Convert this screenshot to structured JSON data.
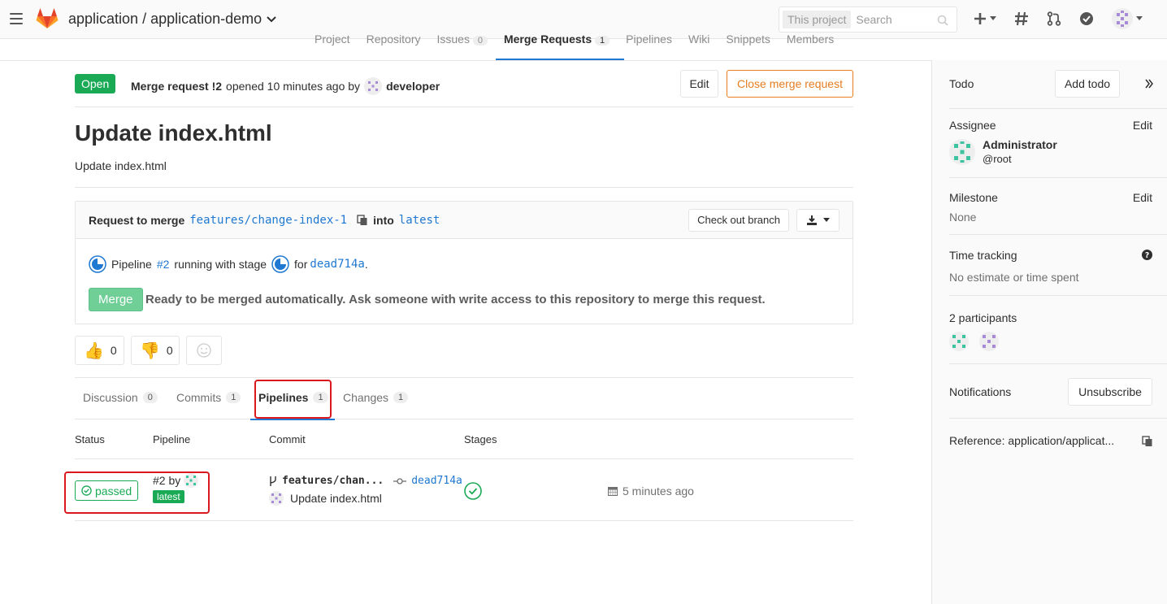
{
  "header": {
    "project_path": "application / application-demo",
    "search_scope": "This project",
    "search_placeholder": "Search"
  },
  "subnav": [
    "Project",
    "Repository",
    "Issues",
    "Merge Requests",
    "Pipelines",
    "Wiki",
    "Snippets",
    "Members"
  ],
  "subnav_counts": {
    "issues": "0",
    "merge_requests": "1"
  },
  "mr": {
    "status": "Open",
    "ref": "Merge request !2",
    "opened": "opened 10 minutes ago by",
    "author": "developer",
    "edit_label": "Edit",
    "close_label": "Close merge request",
    "title": "Update index.html",
    "description": "Update index.html"
  },
  "widget": {
    "request_to_merge": "Request to merge",
    "source_branch": "features/change-index-1",
    "into": "into",
    "target_branch": "latest",
    "checkout_label": "Check out branch",
    "pipeline_prefix": "Pipeline",
    "pipeline_id": "#2",
    "pipeline_running": "running with stage",
    "pipeline_for": "for",
    "commit_sha": "dead714a",
    "merge_label": "Merge",
    "merge_text": "Ready to be merged automatically. Ask someone with write access to this repository to merge this request."
  },
  "awards": {
    "thumbsup": "0",
    "thumbsdown": "0"
  },
  "tabs": [
    {
      "label": "Discussion",
      "count": "0"
    },
    {
      "label": "Commits",
      "count": "1"
    },
    {
      "label": "Pipelines",
      "count": "1"
    },
    {
      "label": "Changes",
      "count": "1"
    }
  ],
  "table": {
    "headers": [
      "Status",
      "Pipeline",
      "Commit",
      "Stages"
    ],
    "row": {
      "status": "passed",
      "pipeline_id": "#2 by",
      "pipeline_tag": "latest",
      "branch": "features/chan...",
      "commit_sha": "dead714a",
      "commit_message": "Update index.html",
      "time": "5 minutes ago"
    }
  },
  "sidebar": {
    "todo_label": "Todo",
    "add_todo": "Add todo",
    "assignee_label": "Assignee",
    "edit": "Edit",
    "assignee_name": "Administrator",
    "assignee_handle": "@root",
    "milestone_label": "Milestone",
    "milestone_value": "None",
    "time_tracking_label": "Time tracking",
    "time_tracking_value": "No estimate or time spent",
    "participants_label": "2 participants",
    "notifications_label": "Notifications",
    "unsubscribe": "Unsubscribe",
    "reference": "Reference: application/applicat..."
  },
  "colors": {
    "accent": "#1f78d1",
    "success": "#1aaa55",
    "warning": "#e67e22",
    "highlight": "#d9191f"
  }
}
